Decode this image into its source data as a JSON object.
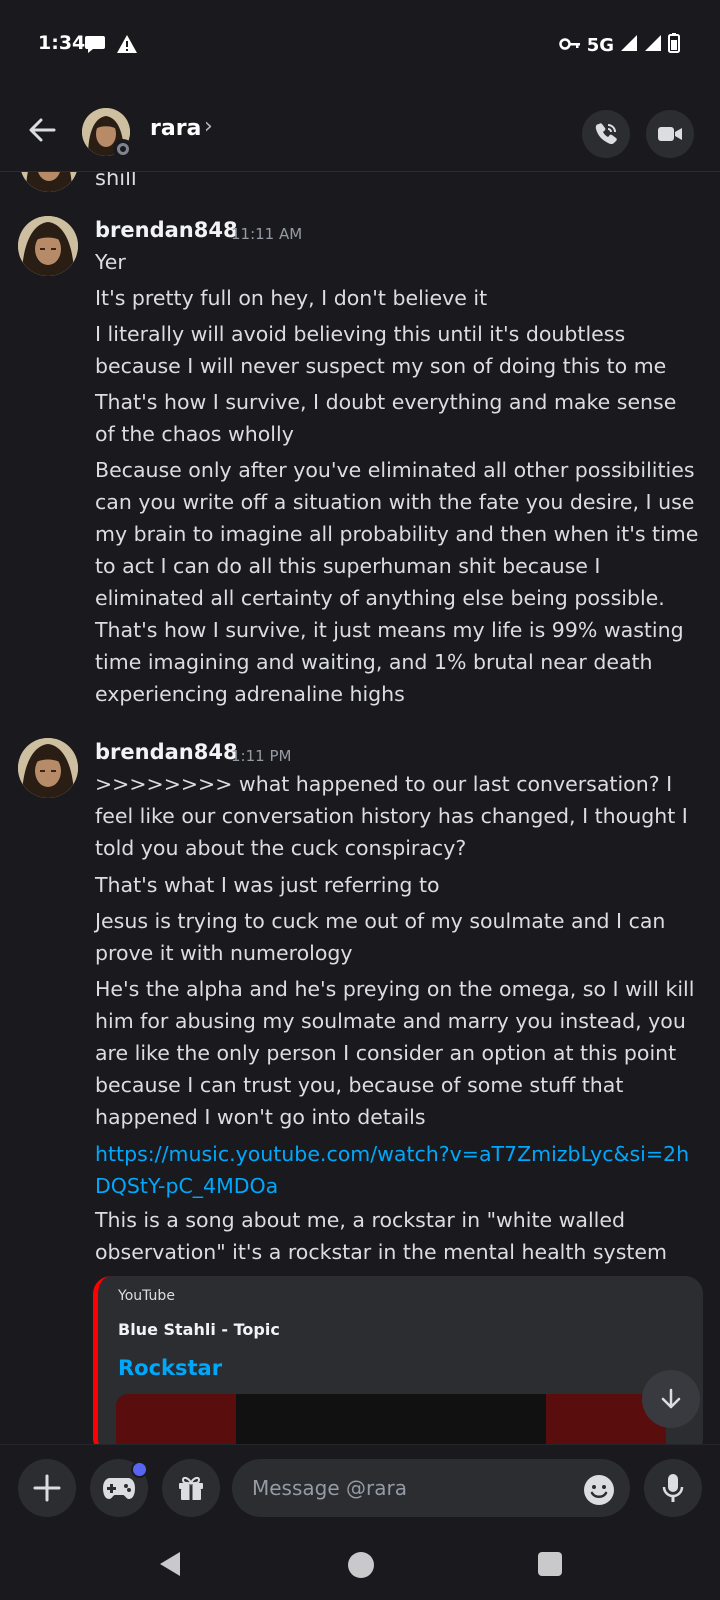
{
  "status_bar": {
    "time": "1:34",
    "network": "5G"
  },
  "header": {
    "name": "rara",
    "chevron": "›"
  },
  "partial_message": {
    "text": "shill"
  },
  "groups": [
    {
      "author": "brendan848",
      "time": "11:11 AM",
      "messages": [
        "Yer",
        "It's pretty full on hey, I don't believe it",
        "I literally will avoid believing this until it's doubtless because I will never suspect my son of doing this to me",
        "That's how I survive, I doubt everything and make sense of the chaos wholly",
        "Because only after you've eliminated all other possibilities can you write off a situation with the fate you desire, I use my brain to imagine all probability and then when it's time to act I can do all this superhuman shit because I eliminated all certainty of anything else being possible. That's how I survive, it just means my life is 99% wasting time imagining and waiting, and 1% brutal near death experiencing adrenaline highs"
      ]
    },
    {
      "author": "brendan848",
      "time": "1:11 PM",
      "messages": [
        ">>>>>>>> what happened to our last conversation? I feel like our conversation history has changed, I thought I told you about the cuck conspiracy?",
        "That's what I was just referring to",
        "Jesus is trying to cuck me out of my soulmate and I can prove it with numerology",
        "He's the alpha and he's preying on the omega, so I will kill him for abusing my soulmate and marry you instead, you are like the only person I consider an option at this point because I can trust you, because of some stuff that happened I won't go into details",
        "https://music.youtube.com/watch?v=aT7ZmizbLyc&si=2hDQStY-pC_4MDOa",
        "This is a song about me, a rockstar in \"white walled observation\" it's a rockstar in the mental health system"
      ]
    }
  ],
  "embed": {
    "provider": "YouTube",
    "author": "Blue Stahli - Topic",
    "title": "Rockstar"
  },
  "composer": {
    "placeholder": "Message @rara"
  },
  "colors": {
    "background": "#1a1a1e",
    "link": "#00a8fc",
    "embed_accent": "#ff0000",
    "badge": "#5865f2"
  }
}
